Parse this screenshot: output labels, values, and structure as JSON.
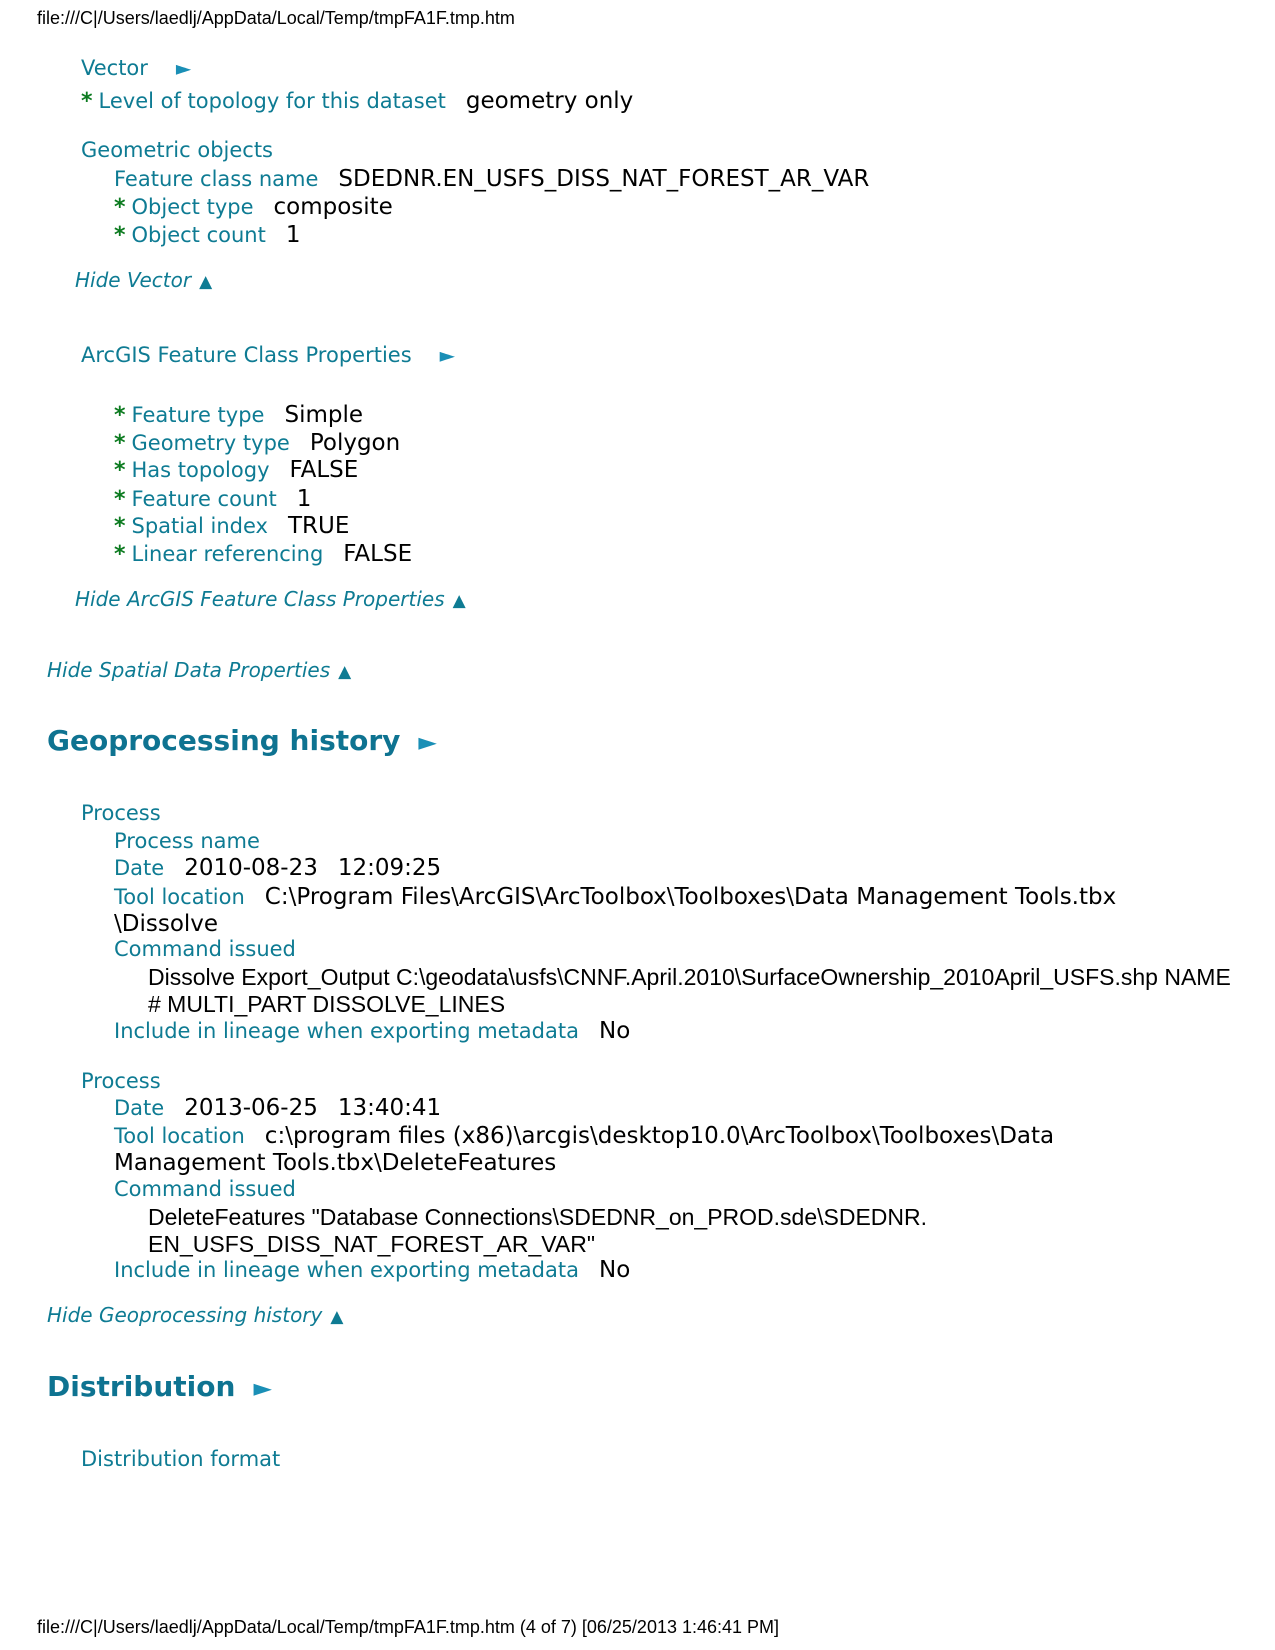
{
  "header_url": "file:///C|/Users/laedlj/AppData/Local/Temp/tmpFA1F.tmp.htm",
  "footer_url": "file:///C|/Users/laedlj/AppData/Local/Temp/tmpFA1F.tmp.htm (4 of 7) [06/25/2013 1:46:41 PM]",
  "vector": {
    "title": "Vector",
    "arrow": "►",
    "topology_label": "Level of topology for this dataset",
    "topology_value": "geometry only",
    "geometric_objects_title": "Geometric objects",
    "feature_class_name_label": "Feature class name",
    "feature_class_name_value": "SDEDNR.EN_USFS_DISS_NAT_FOREST_AR_VAR",
    "object_type_label": "Object type",
    "object_type_value": "composite",
    "object_count_label": "Object count",
    "object_count_value": "1",
    "hide_label": "Hide Vector",
    "hide_arrow": "▲"
  },
  "arcgis": {
    "title": "ArcGIS Feature Class Properties",
    "arrow": "►",
    "rows": [
      {
        "label": "Feature type",
        "value": "Simple"
      },
      {
        "label": "Geometry type",
        "value": "Polygon"
      },
      {
        "label": "Has topology",
        "value": "FALSE"
      },
      {
        "label": "Feature count",
        "value": "1"
      },
      {
        "label": "Spatial index",
        "value": "TRUE"
      },
      {
        "label": "Linear referencing",
        "value": "FALSE"
      }
    ],
    "hide_label": "Hide ArcGIS Feature Class Properties",
    "hide_arrow": "▲"
  },
  "spatial": {
    "hide_label": "Hide Spatial Data Properties",
    "hide_arrow": "▲"
  },
  "geoprocessing": {
    "title": "Geoprocessing history",
    "arrow": "►",
    "process1": {
      "title": "Process",
      "name_label": "Process name",
      "date_label": "Date",
      "date_value": "2010-08-23",
      "time_value": "12:09:25",
      "tool_label": "Tool location",
      "tool_value_line1": "C:\\Program Files\\ArcGIS\\ArcToolbox\\Toolboxes\\Data Management Tools.tbx",
      "tool_value_line2": "\\Dissolve",
      "command_label": "Command issued",
      "command_line1": "Dissolve Export_Output C:\\geodata\\usfs\\CNNF.April.2010\\SurfaceOwnership_2010April_USFS.shp NAME",
      "command_line2": "# MULTI_PART DISSOLVE_LINES",
      "lineage_label": "Include in lineage when exporting metadata",
      "lineage_value": "No"
    },
    "process2": {
      "title": "Process",
      "date_label": "Date",
      "date_value": "2013-06-25",
      "time_value": "13:40:41",
      "tool_label": "Tool location",
      "tool_value_line1": "c:\\program files (x86)\\arcgis\\desktop10.0\\ArcToolbox\\Toolboxes\\Data",
      "tool_value_line2": "Management Tools.tbx\\DeleteFeatures",
      "command_label": "Command issued",
      "command_line1": "DeleteFeatures \"Database Connections\\SDEDNR_on_PROD.sde\\SDEDNR.",
      "command_line2": "EN_USFS_DISS_NAT_FOREST_AR_VAR\"",
      "lineage_label": "Include in lineage when exporting metadata",
      "lineage_value": "No"
    },
    "hide_label": "Hide Geoprocessing history",
    "hide_arrow": "▲"
  },
  "distribution": {
    "title": "Distribution",
    "arrow": "►",
    "format_label": "Distribution format"
  }
}
